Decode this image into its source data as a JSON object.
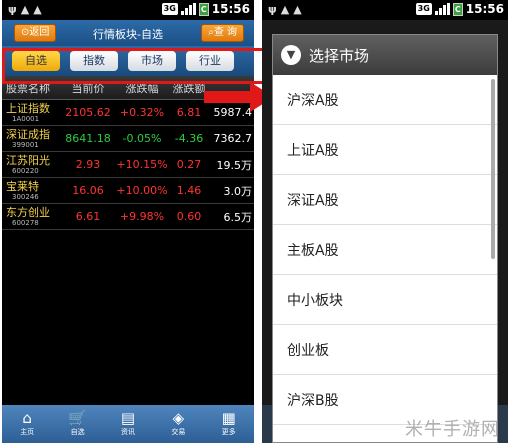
{
  "status_bar": {
    "network": "3G",
    "time": "15:56",
    "battery": "C"
  },
  "left": {
    "title": "行情板块-自选",
    "back_label": "返回",
    "query_label": "查 询",
    "tabs": [
      {
        "label": "自选",
        "active": true
      },
      {
        "label": "指数",
        "active": false
      },
      {
        "label": "市场",
        "active": false
      },
      {
        "label": "行业",
        "active": false
      }
    ],
    "columns": [
      "股票名称",
      "当前价",
      "涨跌幅",
      "涨跌额",
      ""
    ],
    "rows": [
      {
        "name": "上证指数",
        "code": "1A0001",
        "price": "2105.62",
        "pct": "+0.32%",
        "chg": "6.81",
        "vol": "5987.4",
        "color": "red"
      },
      {
        "name": "深证成指",
        "code": "399001",
        "price": "8641.18",
        "pct": "-0.05%",
        "chg": "-4.36",
        "vol": "7362.7",
        "color": "green"
      },
      {
        "name": "江苏阳光",
        "code": "600220",
        "price": "2.93",
        "pct": "+10.15%",
        "chg": "0.27",
        "vol": "19.5万",
        "color": "red"
      },
      {
        "name": "宝莱特",
        "code": "300246",
        "price": "16.06",
        "pct": "+10.00%",
        "chg": "1.46",
        "vol": "3.0万",
        "color": "red"
      },
      {
        "name": "东方创业",
        "code": "600278",
        "price": "6.61",
        "pct": "+9.98%",
        "chg": "0.60",
        "vol": "6.5万",
        "color": "red"
      }
    ],
    "nav": [
      {
        "label": "主页",
        "icon": "home-icon",
        "glyph": "⌂"
      },
      {
        "label": "自选",
        "icon": "cart-icon",
        "glyph": "🛒"
      },
      {
        "label": "资讯",
        "icon": "news-icon",
        "glyph": "▤"
      },
      {
        "label": "交易",
        "icon": "shield-icon",
        "glyph": "◈"
      },
      {
        "label": "更多",
        "icon": "grid-icon",
        "glyph": "▦"
      }
    ]
  },
  "right": {
    "dialog_title": "选择市场",
    "markets": [
      "沪深A股",
      "上证A股",
      "深证A股",
      "主板A股",
      "中小板块",
      "创业板",
      "沪深B股"
    ]
  },
  "watermark": "米牛手游网",
  "colors": {
    "up": "#ff3333",
    "down": "#2ecc40",
    "highlight": "#e01818",
    "accent": "#f0a80a"
  }
}
